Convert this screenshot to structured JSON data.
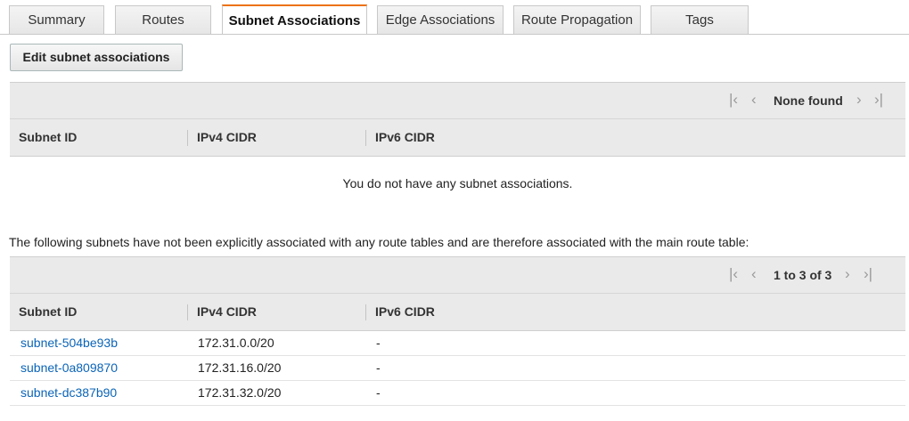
{
  "tabs": [
    {
      "label": "Summary",
      "active": false
    },
    {
      "label": "Routes",
      "active": false
    },
    {
      "label": "Subnet Associations",
      "active": true
    },
    {
      "label": "Edge Associations",
      "active": false
    },
    {
      "label": "Route Propagation",
      "active": false
    },
    {
      "label": "Tags",
      "active": false
    }
  ],
  "edit_button": "Edit subnet associations",
  "explicit_table": {
    "pager_text": "None found",
    "columns": [
      "Subnet ID",
      "IPv4 CIDR",
      "IPv6 CIDR"
    ],
    "empty_message": "You do not have any subnet associations."
  },
  "implicit_note": "The following subnets have not been explicitly associated with any route tables and are therefore associated with the main route table:",
  "implicit_table": {
    "pager_text": "1 to 3 of 3",
    "columns": [
      "Subnet ID",
      "IPv4 CIDR",
      "IPv6 CIDR"
    ],
    "rows": [
      {
        "subnet_id": "subnet-504be93b",
        "ipv4": "172.31.0.0/20",
        "ipv6": "-"
      },
      {
        "subnet_id": "subnet-0a809870",
        "ipv4": "172.31.16.0/20",
        "ipv6": "-"
      },
      {
        "subnet_id": "subnet-dc387b90",
        "ipv4": "172.31.32.0/20",
        "ipv6": "-"
      }
    ]
  },
  "pager_icons": {
    "first": "first-page-icon",
    "prev": "prev-page-icon",
    "next": "next-page-icon",
    "last": "last-page-icon"
  },
  "colors": {
    "accent": "#ec7211",
    "link": "#0b64b7",
    "header_bg": "#eaeaea"
  }
}
